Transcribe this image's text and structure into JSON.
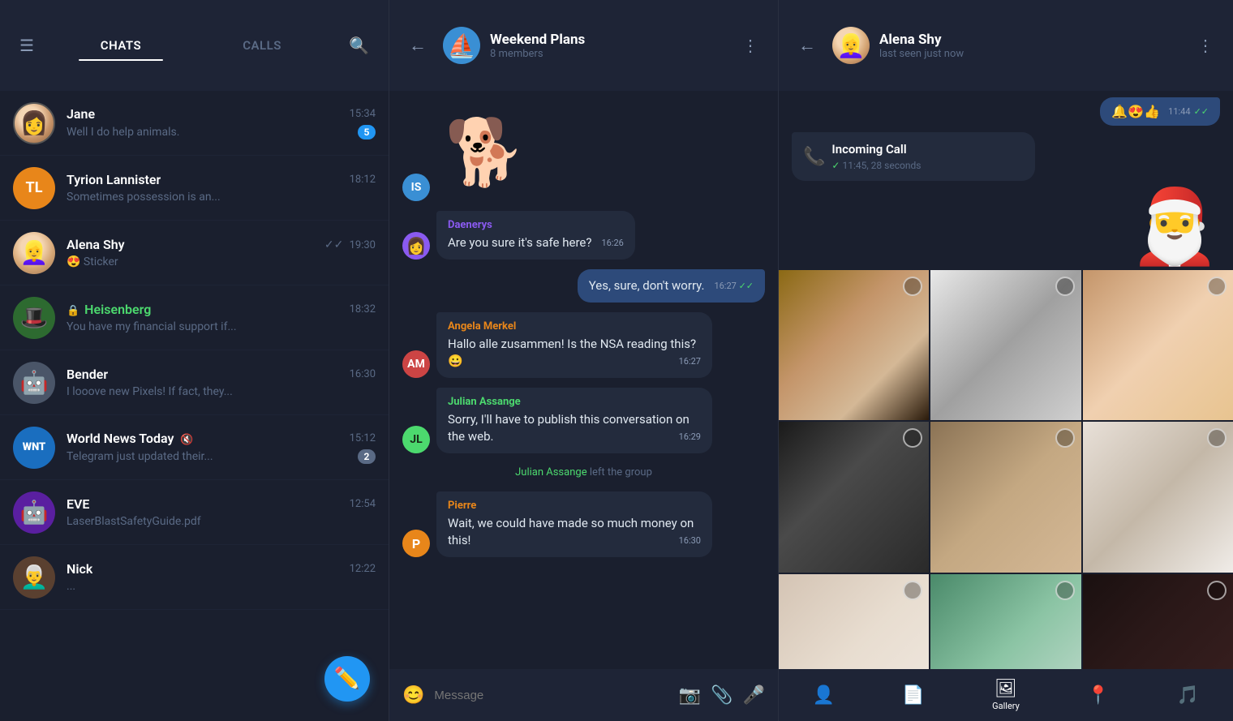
{
  "leftPanel": {
    "tabs": [
      {
        "id": "chats",
        "label": "CHATS",
        "active": true
      },
      {
        "id": "calls",
        "label": "CALLS",
        "active": false
      }
    ],
    "chats": [
      {
        "id": "jane",
        "name": "Jane",
        "preview": "Well I do help animals.",
        "time": "15:34",
        "badge": "5",
        "avatarType": "photo",
        "avatarColor": "orange"
      },
      {
        "id": "tyrion",
        "name": "Tyrion Lannister",
        "preview": "Sometimes possession is an...",
        "time": "18:12",
        "badge": "",
        "avatarType": "initials",
        "avatarInitials": "TL",
        "avatarColor": "orange"
      },
      {
        "id": "alena",
        "name": "Alena Shy",
        "preview": "😍 Sticker",
        "time": "19:30",
        "badge": "",
        "doubleCheck": true,
        "avatarType": "photo",
        "avatarColor": "skin"
      },
      {
        "id": "heisenberg",
        "name": "Heisenberg",
        "preview": "You have my financial support if...",
        "time": "18:32",
        "badge": "",
        "locked": true,
        "nameColor": "green",
        "avatarType": "photo",
        "avatarColor": "green"
      },
      {
        "id": "bender",
        "name": "Bender",
        "preview": "I looove new Pixels! If fact, they...",
        "time": "16:30",
        "badge": "",
        "avatarType": "photo",
        "avatarColor": "gray"
      },
      {
        "id": "wnt",
        "name": "World News Today",
        "preview": "Telegram just updated their...",
        "time": "15:12",
        "badge": "2",
        "muted": true,
        "avatarType": "photo",
        "avatarColor": "blue"
      },
      {
        "id": "eve",
        "name": "EVE",
        "preview": "LaserBlastSafetyGuide.pdf",
        "time": "12:54",
        "badge": "",
        "avatarType": "photo",
        "avatarColor": "purple"
      },
      {
        "id": "nick",
        "name": "Nick",
        "preview": "...",
        "time": "12:22",
        "badge": "",
        "avatarType": "photo",
        "avatarColor": "brown"
      }
    ],
    "fab": "✏️"
  },
  "middlePanel": {
    "header": {
      "title": "Weekend Plans",
      "subtitle": "8 members"
    },
    "messages": [
      {
        "id": "sticker1",
        "type": "sticker",
        "sender": "IS",
        "senderColor": "#3a8fd4"
      },
      {
        "id": "daenerys1",
        "type": "incoming",
        "sender": "Daenerys",
        "senderColor": "#8a5af0",
        "text": "Are you sure it's safe here?",
        "time": "16:26",
        "avatarType": "photo"
      },
      {
        "id": "outgoing1",
        "type": "outgoing",
        "text": "Yes, sure, don't worry.",
        "time": "16:27",
        "check": "double"
      },
      {
        "id": "angela1",
        "type": "incoming",
        "sender": "Angela Merkel",
        "senderColor": "#e8861a",
        "text": "Hallo alle zusammen! Is the NSA reading this? 😀",
        "time": "16:27",
        "avatarInitials": "AM",
        "avatarColor": "#cc4444"
      },
      {
        "id": "julian1",
        "type": "incoming",
        "sender": "Julian Assange",
        "senderColor": "#4cd96e",
        "text": "Sorry, I'll have to publish this conversation on the web.",
        "time": "16:29",
        "avatarInitials": "JL",
        "avatarColor": "#4cd96e"
      },
      {
        "id": "system1",
        "type": "system",
        "text": " Julian Assange ",
        "suffix": "left the group"
      },
      {
        "id": "pierre1",
        "type": "incoming",
        "sender": "Pierre",
        "senderColor": "#e8861a",
        "text": "Wait, we could have made so much money on this!",
        "time": "16:30",
        "avatarInitials": "P",
        "avatarColor": "#e8861a"
      }
    ],
    "inputPlaceholder": "Message"
  },
  "rightPanel": {
    "header": {
      "name": "Alena Shy",
      "status": "last seen just now"
    },
    "callMsg": {
      "title": "Incoming Call",
      "detail": "11:45, 28 seconds",
      "msgTime": "11:44"
    },
    "bottomTabs": [
      {
        "id": "profile",
        "icon": "👤",
        "label": "",
        "active": false
      },
      {
        "id": "files",
        "icon": "📄",
        "label": "",
        "active": false
      },
      {
        "id": "gallery",
        "icon": "🖼",
        "label": "Gallery",
        "active": true
      },
      {
        "id": "location",
        "icon": "📍",
        "label": "",
        "active": false
      },
      {
        "id": "audio",
        "icon": "🎵",
        "label": "",
        "active": false
      }
    ]
  }
}
